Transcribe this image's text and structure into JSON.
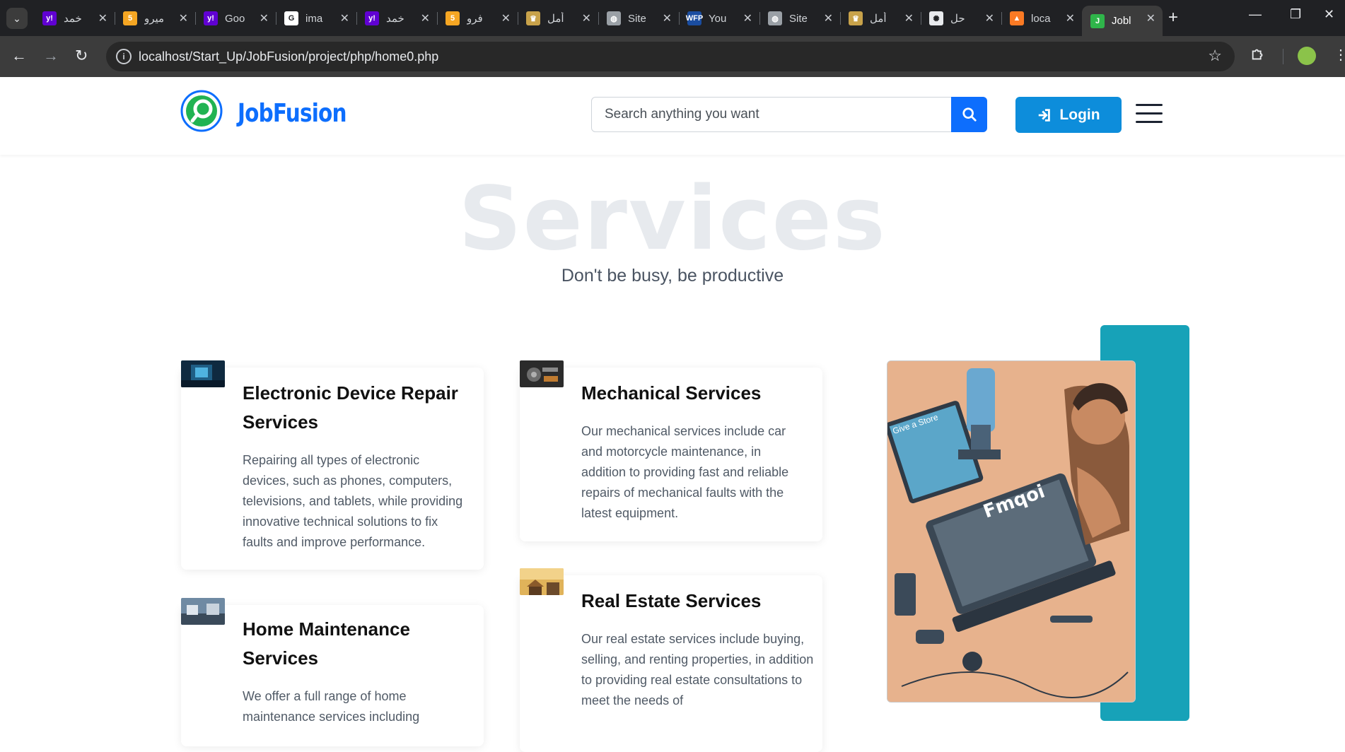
{
  "browser": {
    "tabs": [
      {
        "title": "خمد",
        "favicon": "yahoo-icon",
        "color": "#6001d2",
        "glyph": "y!"
      },
      {
        "title": "ميرو",
        "favicon": "orange-5-icon",
        "color": "#f5a623",
        "glyph": "5"
      },
      {
        "title": "Goo",
        "favicon": "yahoo-icon",
        "color": "#6001d2",
        "glyph": "y!"
      },
      {
        "title": "ima",
        "favicon": "google-icon",
        "color": "#ffffff",
        "glyph": "G"
      },
      {
        "title": "خمد",
        "favicon": "yahoo-icon",
        "color": "#6001d2",
        "glyph": "y!"
      },
      {
        "title": "فرو",
        "favicon": "orange-5-icon",
        "color": "#f5a623",
        "glyph": "5"
      },
      {
        "title": "أمل",
        "favicon": "emblem-icon",
        "color": "#c8a24a",
        "glyph": "♛"
      },
      {
        "title": "Site",
        "favicon": "globe-icon",
        "color": "#9aa0a6",
        "glyph": "◍"
      },
      {
        "title": "You",
        "favicon": "wfp-icon",
        "color": "#1a4da1",
        "glyph": "WFP"
      },
      {
        "title": "Site",
        "favicon": "globe-icon",
        "color": "#9aa0a6",
        "glyph": "◍"
      },
      {
        "title": "أمل",
        "favicon": "emblem-icon",
        "color": "#c8a24a",
        "glyph": "♛"
      },
      {
        "title": "حل",
        "favicon": "openai-icon",
        "color": "#e8eaed",
        "glyph": "✺"
      },
      {
        "title": "loca",
        "favicon": "xampp-icon",
        "color": "#fb7a24",
        "glyph": "▲"
      },
      {
        "title": "Jobl",
        "favicon": "jobfusion-icon",
        "color": "#2fb54a",
        "glyph": "J",
        "active": true
      }
    ],
    "url": "localhost/Start_Up/JobFusion/project/php/home0.php"
  },
  "header": {
    "logo_text": "JobFusion",
    "search_placeholder": "Search anything you want",
    "login_label": "Login",
    "brand_color": "#0d6efd",
    "login_color": "#0d8ddb"
  },
  "section": {
    "background_title": "Services",
    "subtitle": "Don't be busy, be productive"
  },
  "services": [
    {
      "title_line1": "Electronic Device Repair",
      "title_line2": "Services",
      "description": "Repairing all types of electronic devices, such as phones, computers, televisions, and tablets, while providing innovative technical solutions to fix faults and improve performance."
    },
    {
      "title_line1": "Mechanical Services",
      "title_line2": "",
      "description": "Our mechanical services include car and motorcycle maintenance, in addition to providing fast and reliable repairs of mechanical faults with the latest equipment."
    },
    {
      "title_line1": "Home Maintenance",
      "title_line2": "Services",
      "description": "We offer a full range of home maintenance services including"
    },
    {
      "title_line1": "Real Estate Services",
      "title_line2": "",
      "description": "Our real estate services include buying, selling, and renting properties, in addition to providing real estate consultations to meet the needs of"
    }
  ],
  "illustration": {
    "screen_text": "Fmqoi",
    "panel_text": "Give a Store",
    "accent_color": "#17a2b8"
  }
}
